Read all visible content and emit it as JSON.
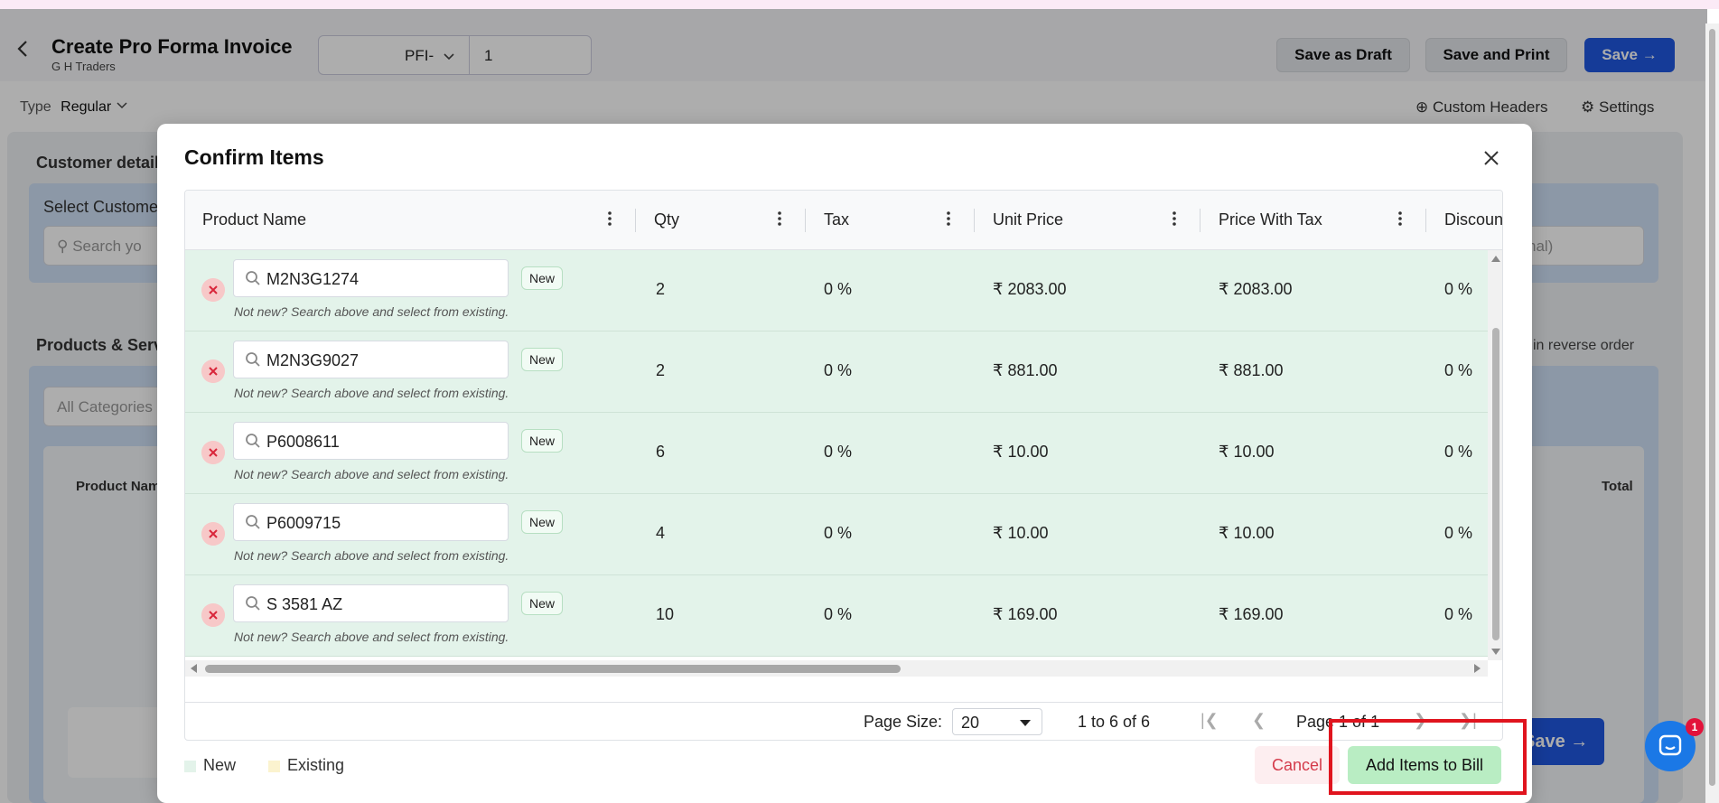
{
  "header": {
    "title": "Create Pro Forma Invoice",
    "subtitle": "G H Traders",
    "prefix": "PFI-",
    "number": "1",
    "save_draft": "Save as Draft",
    "save_print": "Save and Print",
    "save": "Save"
  },
  "type_row": {
    "label": "Type",
    "value": "Regular"
  },
  "toolbar": {
    "custom_headers": "Custom Headers",
    "settings": "Settings"
  },
  "background": {
    "customer_details": "Customer detail",
    "select_customer": "Select Custome",
    "search_placeholder": "Search yo",
    "notes_tail": "nal)",
    "products_services": "Products & Serv",
    "reverse_order": "in reverse order",
    "all_categories": "All Categories",
    "product_name_col": "Product Nam",
    "total_col": "Total",
    "save": "Save"
  },
  "modal": {
    "title": "Confirm Items",
    "columns": [
      "Product Name",
      "Qty",
      "Tax",
      "Unit Price",
      "Price With Tax",
      "Discoun"
    ],
    "badge_new": "New",
    "hint": "Not new? Search above and select from existing.",
    "rows": [
      {
        "product": "M2N3G1274",
        "qty": "2",
        "tax": "0 %",
        "unit_price": "₹ 2083.00",
        "price_with_tax": "₹ 2083.00",
        "discount": "0 %"
      },
      {
        "product": "M2N3G9027",
        "qty": "2",
        "tax": "0 %",
        "unit_price": "₹ 881.00",
        "price_with_tax": "₹ 881.00",
        "discount": "0 %"
      },
      {
        "product": "P6008611",
        "qty": "6",
        "tax": "0 %",
        "unit_price": "₹ 10.00",
        "price_with_tax": "₹ 10.00",
        "discount": "0 %"
      },
      {
        "product": "P6009715",
        "qty": "4",
        "tax": "0 %",
        "unit_price": "₹ 10.00",
        "price_with_tax": "₹ 10.00",
        "discount": "0 %"
      },
      {
        "product": "S 3581 AZ",
        "qty": "10",
        "tax": "0 %",
        "unit_price": "₹ 169.00",
        "price_with_tax": "₹ 169.00",
        "discount": "0 %"
      }
    ],
    "pager": {
      "page_size_label": "Page Size:",
      "page_size": "20",
      "count": "1 to 6 of 6",
      "page": "Page 1 of 1"
    },
    "legend": {
      "new": "New",
      "existing": "Existing",
      "new_color": "#e3f3ea",
      "existing_color": "#fbf3cf"
    },
    "cancel": "Cancel",
    "add_items": "Add Items to Bill"
  },
  "chat": {
    "badge": "1"
  },
  "colors": {
    "primary": "#1f57e0",
    "row_new": "#e3f3ea",
    "highlight": "#e0141e",
    "add_button": "#b9edc3"
  }
}
